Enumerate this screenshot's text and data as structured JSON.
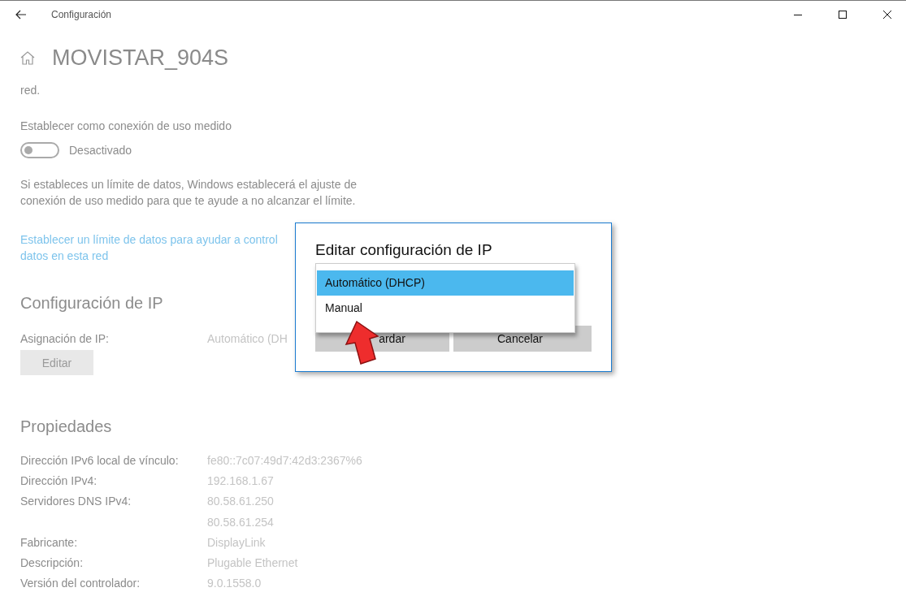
{
  "window": {
    "title": "Configuración"
  },
  "page": {
    "title": "MOVISTAR_904S",
    "intro_tail": "red."
  },
  "metered": {
    "label": "Establecer como conexión de uso medido",
    "toggle": {
      "on": false,
      "label": "Desactivado"
    },
    "note": "Si estableces un límite de datos, Windows establecerá el ajuste de conexión de uso medido para que te ayude a no alcanzar el límite.",
    "link_lines": [
      "Establecer un límite de datos para ayudar a control",
      "datos en esta red"
    ]
  },
  "ip": {
    "heading": "Configuración de IP",
    "label": "Asignación de IP:",
    "value": "Automático (DH",
    "button": "Editar"
  },
  "properties": {
    "heading": "Propiedades",
    "rows": [
      {
        "label": "Dirección IPv6 local de vínculo:",
        "values": [
          "fe80::7c07:49d7:42d3:2367%6"
        ]
      },
      {
        "label": "Dirección IPv4:",
        "values": [
          "192.168.1.67"
        ]
      },
      {
        "label": "Servidores DNS IPv4:",
        "values": [
          "80.58.61.250",
          "80.58.61.254"
        ]
      },
      {
        "label": "Fabricante:",
        "values": [
          "DisplayLink"
        ]
      },
      {
        "label": "Descripción:",
        "values": [
          "Plugable Ethernet"
        ]
      },
      {
        "label": "Versión del controlador:",
        "values": [
          "9.0.1558.0"
        ]
      }
    ]
  },
  "dialog": {
    "title": "Editar configuración de IP",
    "options": [
      {
        "label": "Automático (DHCP)",
        "selected": true
      },
      {
        "label": "Manual",
        "selected": false
      }
    ],
    "buttons": [
      "ardar",
      "Cancelar"
    ]
  }
}
